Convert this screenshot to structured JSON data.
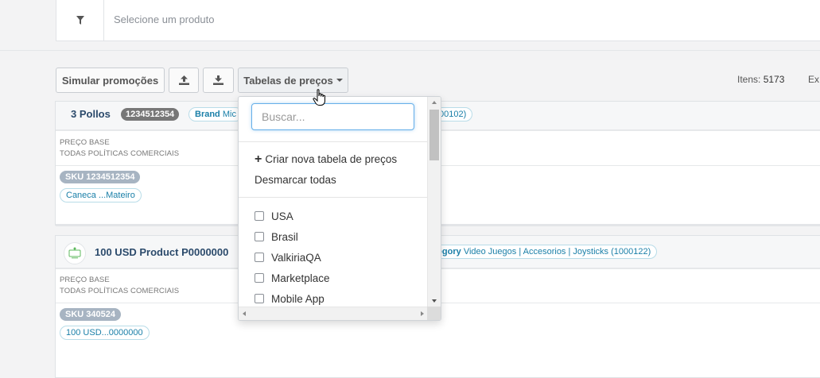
{
  "filter": {
    "placeholder": "Selecione um produto"
  },
  "toolbar": {
    "simulate_label": "Simular promoções",
    "tables_label": "Tabelas de preços",
    "items_label": "Itens:",
    "items_count": "5173",
    "ex_label": "Ex"
  },
  "products": [
    {
      "name": "3 Pollos",
      "sku_code": "1234512354",
      "brand_prefix": "Brand",
      "brand_partial": "Mic",
      "category_tail": "00102)",
      "base_price_label": "PREÇO BASE",
      "policies_label": "TODAS POLÍTICAS COMERCIAIS",
      "sku_label": "SKU 1234512354",
      "sku_name": "Caneca ...Mateiro"
    },
    {
      "name": "100 USD Product P0000000",
      "category_prefix": "ategory",
      "category_text": "Video Juegos | Accesorios | Joysticks (1000122)",
      "base_price_label": "PREÇO BASE",
      "policies_label": "TODAS POLÍTICAS COMERCIAIS",
      "sku_label": "SKU 340524",
      "sku_name": "100 USD...0000000"
    }
  ],
  "dropdown": {
    "search_placeholder": "Buscar...",
    "create_label": "Criar nova tabela de preços",
    "unselect_label": "Desmarcar todas",
    "options": [
      "USA",
      "Brasil",
      "ValkiriaQA",
      "Marketplace",
      "Mobile App"
    ]
  },
  "colors": {
    "accent": "#1a7fa8",
    "title": "#2b4a6b",
    "focus": "#66afe9"
  }
}
